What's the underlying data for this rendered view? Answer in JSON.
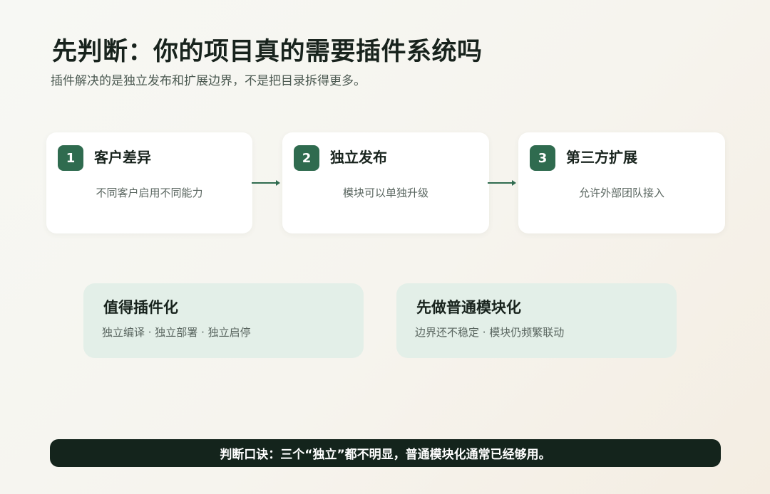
{
  "header": {
    "title": "先判断：你的项目真的需要插件系统吗",
    "subtitle": "插件解决的是独立发布和扩展边界，不是把目录拆得更多。"
  },
  "steps": [
    {
      "number": "1",
      "title": "客户差异",
      "desc": "不同客户启用不同能力"
    },
    {
      "number": "2",
      "title": "独立发布",
      "desc": "模块可以单独升级"
    },
    {
      "number": "3",
      "title": "第三方扩展",
      "desc": "允许外部团队接入"
    }
  ],
  "options": [
    {
      "title": "值得插件化",
      "desc": "独立编译 · 独立部署 · 独立启停"
    },
    {
      "title": "先做普通模块化",
      "desc": "边界还不稳定 · 模块仍频繁联动"
    }
  ],
  "footer": {
    "text": "判断口诀：三个“独立”都不明显，普通模块化通常已经够用。"
  },
  "colors": {
    "accent": "#2f6b4f",
    "option_bg": "#e3efe8",
    "footer_bg": "#14241c"
  }
}
